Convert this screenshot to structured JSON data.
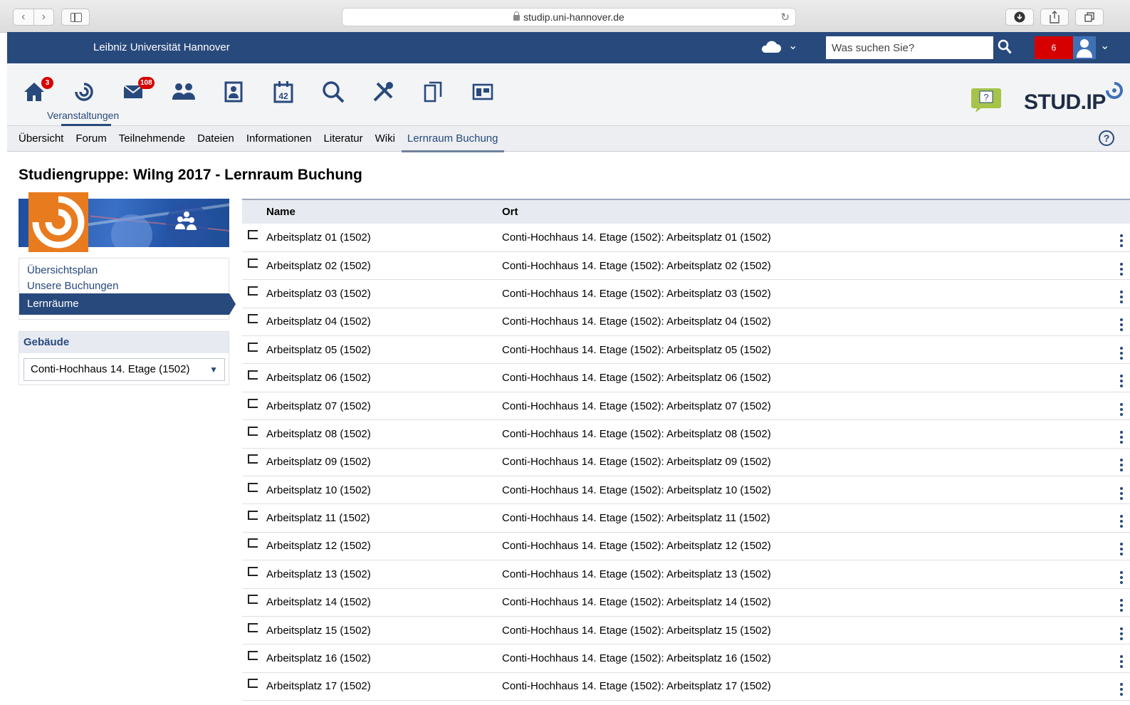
{
  "browser": {
    "url": "studip.uni-hannover.de"
  },
  "header": {
    "university": "Leibniz Universität Hannover",
    "search_placeholder": "Was suchen Sie?",
    "notification_count": "6"
  },
  "icon_nav": {
    "home_badge": "3",
    "messages_badge": "108",
    "active_label": "Veranstaltungen",
    "calendar_day": "42"
  },
  "logo": {
    "text_main": "STUD",
    "text_sep": ".",
    "text_end": "IP"
  },
  "tabs": [
    {
      "label": "Übersicht"
    },
    {
      "label": "Forum"
    },
    {
      "label": "Teilnehmende"
    },
    {
      "label": "Dateien"
    },
    {
      "label": "Informationen"
    },
    {
      "label": "Literatur"
    },
    {
      "label": "Wiki"
    },
    {
      "label": "Lernraum Buchung"
    }
  ],
  "page_title": "Studiengruppe: WiIng 2017 - Lernraum Buchung",
  "sidebar": {
    "links": [
      {
        "label": "Übersichtsplan"
      },
      {
        "label": "Unsere Buchungen"
      }
    ],
    "active": "Lernräume",
    "filter_title": "Gebäude",
    "building_selected": "Conti-Hochhaus 14. Etage (1502)"
  },
  "table": {
    "headers": {
      "name": "Name",
      "ort": "Ort"
    },
    "rows": [
      {
        "name": "Arbeitsplatz 01 (1502)",
        "ort": "Conti-Hochhaus 14. Etage (1502): Arbeitsplatz 01 (1502)"
      },
      {
        "name": "Arbeitsplatz 02 (1502)",
        "ort": "Conti-Hochhaus 14. Etage (1502): Arbeitsplatz 02 (1502)"
      },
      {
        "name": "Arbeitsplatz 03 (1502)",
        "ort": "Conti-Hochhaus 14. Etage (1502): Arbeitsplatz 03 (1502)"
      },
      {
        "name": "Arbeitsplatz 04 (1502)",
        "ort": "Conti-Hochhaus 14. Etage (1502): Arbeitsplatz 04 (1502)"
      },
      {
        "name": "Arbeitsplatz 05 (1502)",
        "ort": "Conti-Hochhaus 14. Etage (1502): Arbeitsplatz 05 (1502)"
      },
      {
        "name": "Arbeitsplatz 06 (1502)",
        "ort": "Conti-Hochhaus 14. Etage (1502): Arbeitsplatz 06 (1502)"
      },
      {
        "name": "Arbeitsplatz 07 (1502)",
        "ort": "Conti-Hochhaus 14. Etage (1502): Arbeitsplatz 07 (1502)"
      },
      {
        "name": "Arbeitsplatz 08 (1502)",
        "ort": "Conti-Hochhaus 14. Etage (1502): Arbeitsplatz 08 (1502)"
      },
      {
        "name": "Arbeitsplatz 09 (1502)",
        "ort": "Conti-Hochhaus 14. Etage (1502): Arbeitsplatz 09 (1502)"
      },
      {
        "name": "Arbeitsplatz 10 (1502)",
        "ort": "Conti-Hochhaus 14. Etage (1502): Arbeitsplatz 10 (1502)"
      },
      {
        "name": "Arbeitsplatz 11 (1502)",
        "ort": "Conti-Hochhaus 14. Etage (1502): Arbeitsplatz 11 (1502)"
      },
      {
        "name": "Arbeitsplatz 12 (1502)",
        "ort": "Conti-Hochhaus 14. Etage (1502): Arbeitsplatz 12 (1502)"
      },
      {
        "name": "Arbeitsplatz 13 (1502)",
        "ort": "Conti-Hochhaus 14. Etage (1502): Arbeitsplatz 13 (1502)"
      },
      {
        "name": "Arbeitsplatz 14 (1502)",
        "ort": "Conti-Hochhaus 14. Etage (1502): Arbeitsplatz 14 (1502)"
      },
      {
        "name": "Arbeitsplatz 15 (1502)",
        "ort": "Conti-Hochhaus 14. Etage (1502): Arbeitsplatz 15 (1502)"
      },
      {
        "name": "Arbeitsplatz 16 (1502)",
        "ort": "Conti-Hochhaus 14. Etage (1502): Arbeitsplatz 16 (1502)"
      },
      {
        "name": "Arbeitsplatz 17 (1502)",
        "ort": "Conti-Hochhaus 14. Etage (1502): Arbeitsplatz 17 (1502)"
      }
    ]
  },
  "colors": {
    "brand_blue": "#28497c",
    "badge_red": "#d60000",
    "logo_orange": "#e97b1f"
  }
}
